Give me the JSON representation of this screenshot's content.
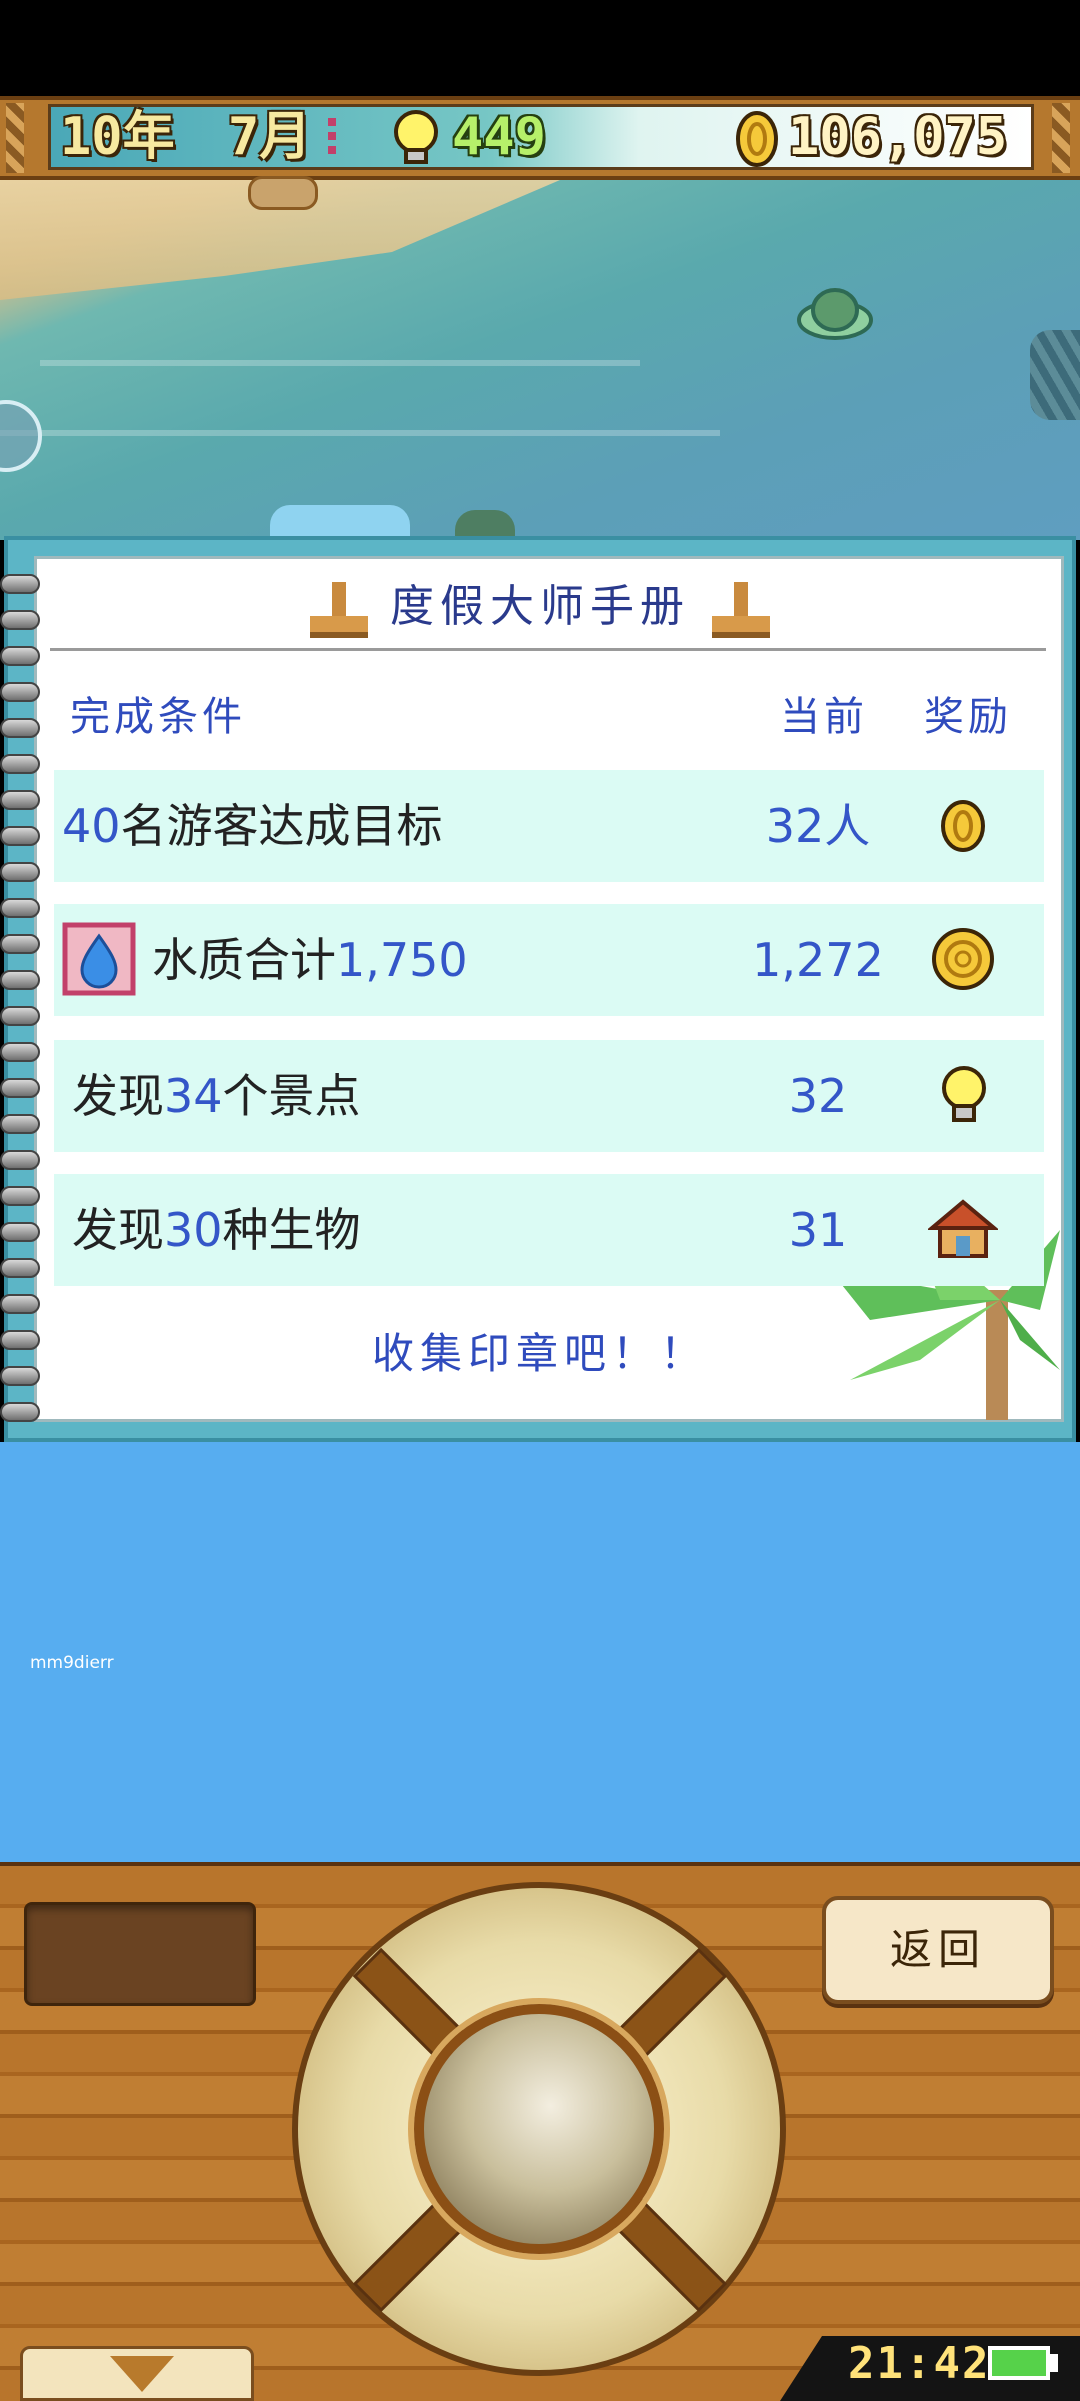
{
  "hud": {
    "year": "10年",
    "month": "7月",
    "ideas": "449",
    "money": "106,075"
  },
  "notebook": {
    "title": "度假大师手册",
    "header_condition": "完成条件",
    "header_current": "当前",
    "header_reward": "奖励",
    "rows": [
      {
        "pre": "",
        "num": "40",
        "post": "名游客达成目标",
        "current": "32人",
        "reward_icon": "gold-coin-icon"
      },
      {
        "pre": "水质合计",
        "num": "1,750",
        "post": "",
        "current": "1,272",
        "reward_icon": "large-coin-icon",
        "row_icon": "water-drop-icon"
      },
      {
        "pre": "发现",
        "num": "34",
        "post": "个景点",
        "current": "32",
        "reward_icon": "lightbulb-icon"
      },
      {
        "pre": "发现",
        "num": "30",
        "post": "种生物",
        "current": "31",
        "reward_icon": "house-icon"
      }
    ],
    "footer": "收集印章吧！！"
  },
  "overlay": {
    "username": "mm9dierr"
  },
  "controls": {
    "back_label": "返回"
  },
  "status": {
    "time": "21:42"
  },
  "colors": {
    "accent_blue": "#3456c8",
    "row_bg": "#dbfbf4",
    "wood": "#b8752c",
    "blue_area": "#57adf0"
  }
}
